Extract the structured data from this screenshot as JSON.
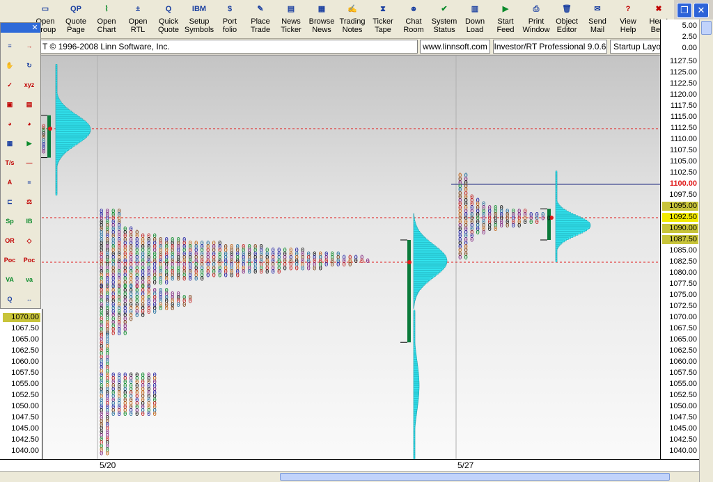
{
  "toolbar": {
    "items": [
      {
        "label1": "Open",
        "label2": "Group",
        "icon": "folder-icon",
        "glyph": "▭"
      },
      {
        "label1": "Quote",
        "label2": "Page",
        "icon": "quote-page-icon",
        "glyph": "QP"
      },
      {
        "label1": "Open",
        "label2": "Chart",
        "icon": "chart-icon",
        "glyph": "⌇"
      },
      {
        "label1": "Open",
        "label2": "RTL",
        "icon": "rtl-icon",
        "glyph": "±"
      },
      {
        "label1": "Quick",
        "label2": "Quote",
        "icon": "quick-quote-icon",
        "glyph": "Q"
      },
      {
        "label1": "Setup",
        "label2": "Symbols",
        "icon": "symbols-icon",
        "glyph": "IBM"
      },
      {
        "label1": "Port",
        "label2": "folio",
        "icon": "portfolio-icon",
        "glyph": "$"
      },
      {
        "label1": "Place",
        "label2": "Trade",
        "icon": "trade-icon",
        "glyph": "✎"
      },
      {
        "label1": "News",
        "label2": "Ticker",
        "icon": "news-ticker-icon",
        "glyph": "▤"
      },
      {
        "label1": "Browse",
        "label2": "News",
        "icon": "browse-news-icon",
        "glyph": "▦"
      },
      {
        "label1": "Trading",
        "label2": "Notes",
        "icon": "notes-icon",
        "glyph": "✍"
      },
      {
        "label1": "Ticker",
        "label2": "Tape",
        "icon": "tape-icon",
        "glyph": "⧗"
      },
      {
        "label1": "Chat",
        "label2": "Room",
        "icon": "chat-icon",
        "glyph": "☻"
      },
      {
        "label1": "System",
        "label2": "Status",
        "icon": "status-icon",
        "glyph": "✔"
      },
      {
        "label1": "Down",
        "label2": "Load",
        "icon": "download-icon",
        "glyph": "▥"
      },
      {
        "label1": "Start",
        "label2": "Feed",
        "icon": "start-feed-icon",
        "glyph": "▶"
      },
      {
        "label1": "Print",
        "label2": "Window",
        "icon": "print-icon",
        "glyph": "⎙"
      },
      {
        "label1": "Object",
        "label2": "Editor",
        "icon": "trash-icon",
        "glyph": "🗑"
      },
      {
        "label1": "Send",
        "label2": "Mail",
        "icon": "mail-icon",
        "glyph": "✉"
      },
      {
        "label1": "View",
        "label2": "Help",
        "icon": "help-icon",
        "glyph": "?"
      },
      {
        "label1": "Heart",
        "label2": "Beat",
        "icon": "heartbeat-icon",
        "glyph": "✖"
      }
    ]
  },
  "statusbar": {
    "copyright": "T © 1996-2008 Linn Software, Inc.",
    "url": "www.linnsoft.com",
    "version": "Investor/RT Professional 9.0.6",
    "layout": "Startup Layout"
  },
  "colors": {
    "profile": "#33e6f0",
    "bracket": "#0a7a3a",
    "redline": "#e01818",
    "blueline": "#1a237e",
    "highlight": "#c8c43a"
  },
  "yaxis": {
    "top_labels": [
      "5.00",
      "2.50",
      "0.00"
    ],
    "labels": [
      "1127.50",
      "1125.00",
      "1122.50",
      "1120.00",
      "1117.50",
      "1115.00",
      "1112.50",
      "1110.00",
      "1107.50",
      "1105.00",
      "1102.50",
      "1100.00",
      "1097.50",
      "1095.00",
      "1092.50",
      "1090.00",
      "1087.50",
      "1085.00",
      "1082.50",
      "1080.00",
      "1077.50",
      "1075.00",
      "1072.50",
      "1070.00",
      "1067.50",
      "1065.00",
      "1062.50",
      "1060.00",
      "1057.50",
      "1055.00",
      "1052.50",
      "1050.00",
      "1047.50",
      "1045.00",
      "1042.50",
      "1040.00"
    ]
  },
  "leftaxis": {
    "labels": [
      "1070.00",
      "1067.50",
      "1065.00",
      "1062.50",
      "1060.00",
      "1057.50",
      "1055.00",
      "1052.50",
      "1050.00",
      "1047.50",
      "1045.00",
      "1042.50",
      "1040.00"
    ]
  },
  "xaxis": {
    "labels": [
      "5/20",
      "5/27"
    ]
  },
  "levels": {
    "price_line": "1100.00",
    "value_high": "1095.00",
    "poc": "1092.50",
    "value_mid": "1090.00",
    "value_low": "1087.50",
    "left_highlight": "1070.00"
  }
}
